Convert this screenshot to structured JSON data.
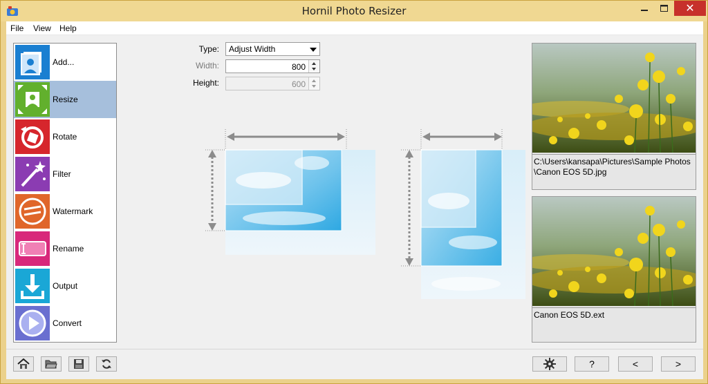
{
  "window": {
    "title": "Hornil Photo Resizer",
    "close_symbol": "✕"
  },
  "menu": {
    "items": [
      "File",
      "View",
      "Help"
    ]
  },
  "sidebar": {
    "items": [
      {
        "label": "Add...",
        "icon": "add-photo-icon",
        "color": "#1a7fd1"
      },
      {
        "label": "Resize",
        "icon": "resize-icon",
        "color": "#62b02d"
      },
      {
        "label": "Rotate",
        "icon": "rotate-icon",
        "color": "#d6262c"
      },
      {
        "label": "Filter",
        "icon": "magic-wand-icon",
        "color": "#8b3cb2"
      },
      {
        "label": "Watermark",
        "icon": "watermark-icon",
        "color": "#e0662a"
      },
      {
        "label": "Rename",
        "icon": "rename-icon",
        "color": "#d8287b"
      },
      {
        "label": "Output",
        "icon": "download-icon",
        "color": "#1aa7d6"
      },
      {
        "label": "Convert",
        "icon": "play-icon",
        "color": "#6a6fd0"
      }
    ],
    "selected": "Resize"
  },
  "settings": {
    "type_label": "Type:",
    "type_value": "Adjust Width",
    "width_label": "Width:",
    "width_value": "800",
    "height_label": "Height:",
    "height_value": "600"
  },
  "previews": {
    "source_caption": "C:\\Users\\kansapa\\Pictures\\Sample Photos\\Canon EOS 5D.jpg",
    "output_caption": "Canon EOS 5D.ext"
  },
  "toolbar": {
    "help_label": "?",
    "prev_label": "<",
    "next_label": ">"
  }
}
